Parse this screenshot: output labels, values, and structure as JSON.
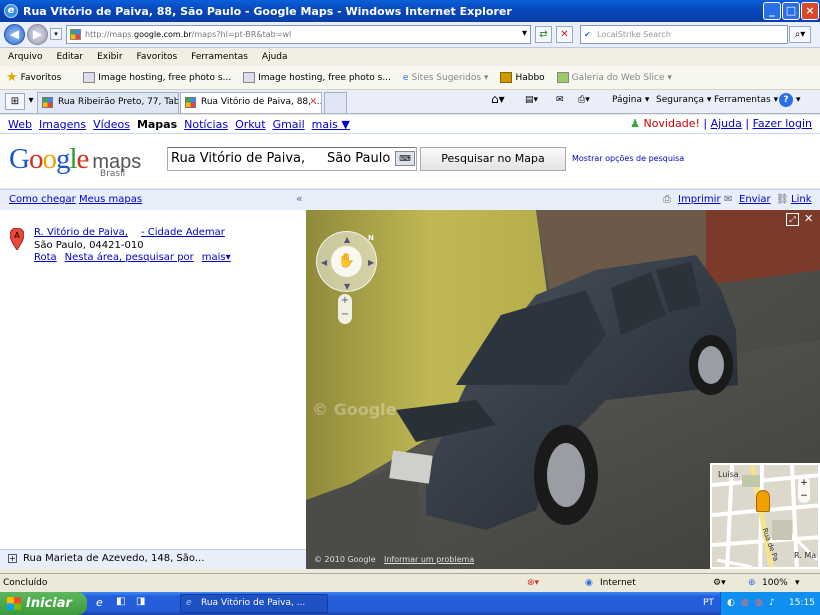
{
  "window": {
    "title": "Rua Vitório de Paiva, 88, São Paulo - Google Maps - Windows Internet Explorer"
  },
  "address": {
    "url_prefix": "http://maps.",
    "url_domain": "google.com.br",
    "url_rest": "/maps?hl=pt-BR&tab=wl",
    "search_placeholder": "LocalStrike Search"
  },
  "menu": [
    "Arquivo",
    "Editar",
    "Exibir",
    "Favoritos",
    "Ferramentas",
    "Ajuda"
  ],
  "favbar": {
    "favorites": "Favoritos",
    "items": [
      "Image hosting, free photo s...",
      "Image hosting, free photo s...",
      "Sites Sugeridos",
      "Habbo",
      "Galeria do Web Slice"
    ]
  },
  "tabs": [
    "Rua Ribeirão Preto, 77, Tabo...",
    "Rua Vitório de Paiva, 88, ..."
  ],
  "toolbar": {
    "page": "Página",
    "security": "Segurança",
    "tools": "Ferramentas"
  },
  "gbar": {
    "items": [
      "Web",
      "Imagens",
      "Vídeos",
      "Mapas",
      "Notícias",
      "Orkut",
      "Gmail",
      "mais ▼"
    ],
    "new": "Novidade!",
    "help": "Ajuda",
    "login": "Fazer login"
  },
  "maps": {
    "logo_google": "Google",
    "logo_maps": "maps",
    "logo_sub": "Brasil",
    "search_part1": "Rua Vitório de Paiva,",
    "search_part2": "São Paulo",
    "search_button": "Pesquisar no Mapa",
    "search_options": "Mostrar opções de pesquisa",
    "directions": "Como chegar",
    "my_maps": "Meus mapas",
    "print": "Imprimir",
    "send": "Enviar",
    "link": "Link",
    "result": {
      "title": "R. Vitório de Paiva,",
      "title2": "- Cidade Ademar",
      "addr": "São Paulo, 04421-010",
      "route": "Rota",
      "nearby": "Nesta área, pesquisar por",
      "more": "mais▾"
    },
    "recent": "Rua Marieta de Azevedo, 148, São...",
    "copyright": "© 2010 Google",
    "report": "Informar um problema",
    "watermark": "© Google",
    "minimap": {
      "label1": "Luisa",
      "label2": "R. Ma",
      "label3": "Rua de Pa"
    }
  },
  "status": {
    "left": "Concluído",
    "zone": "Internet",
    "zoom": "100%"
  },
  "taskbar": {
    "start": "Iniciar",
    "item": "Rua Vitório de Paiva, ...",
    "lang": "PT",
    "time": "15:15"
  }
}
